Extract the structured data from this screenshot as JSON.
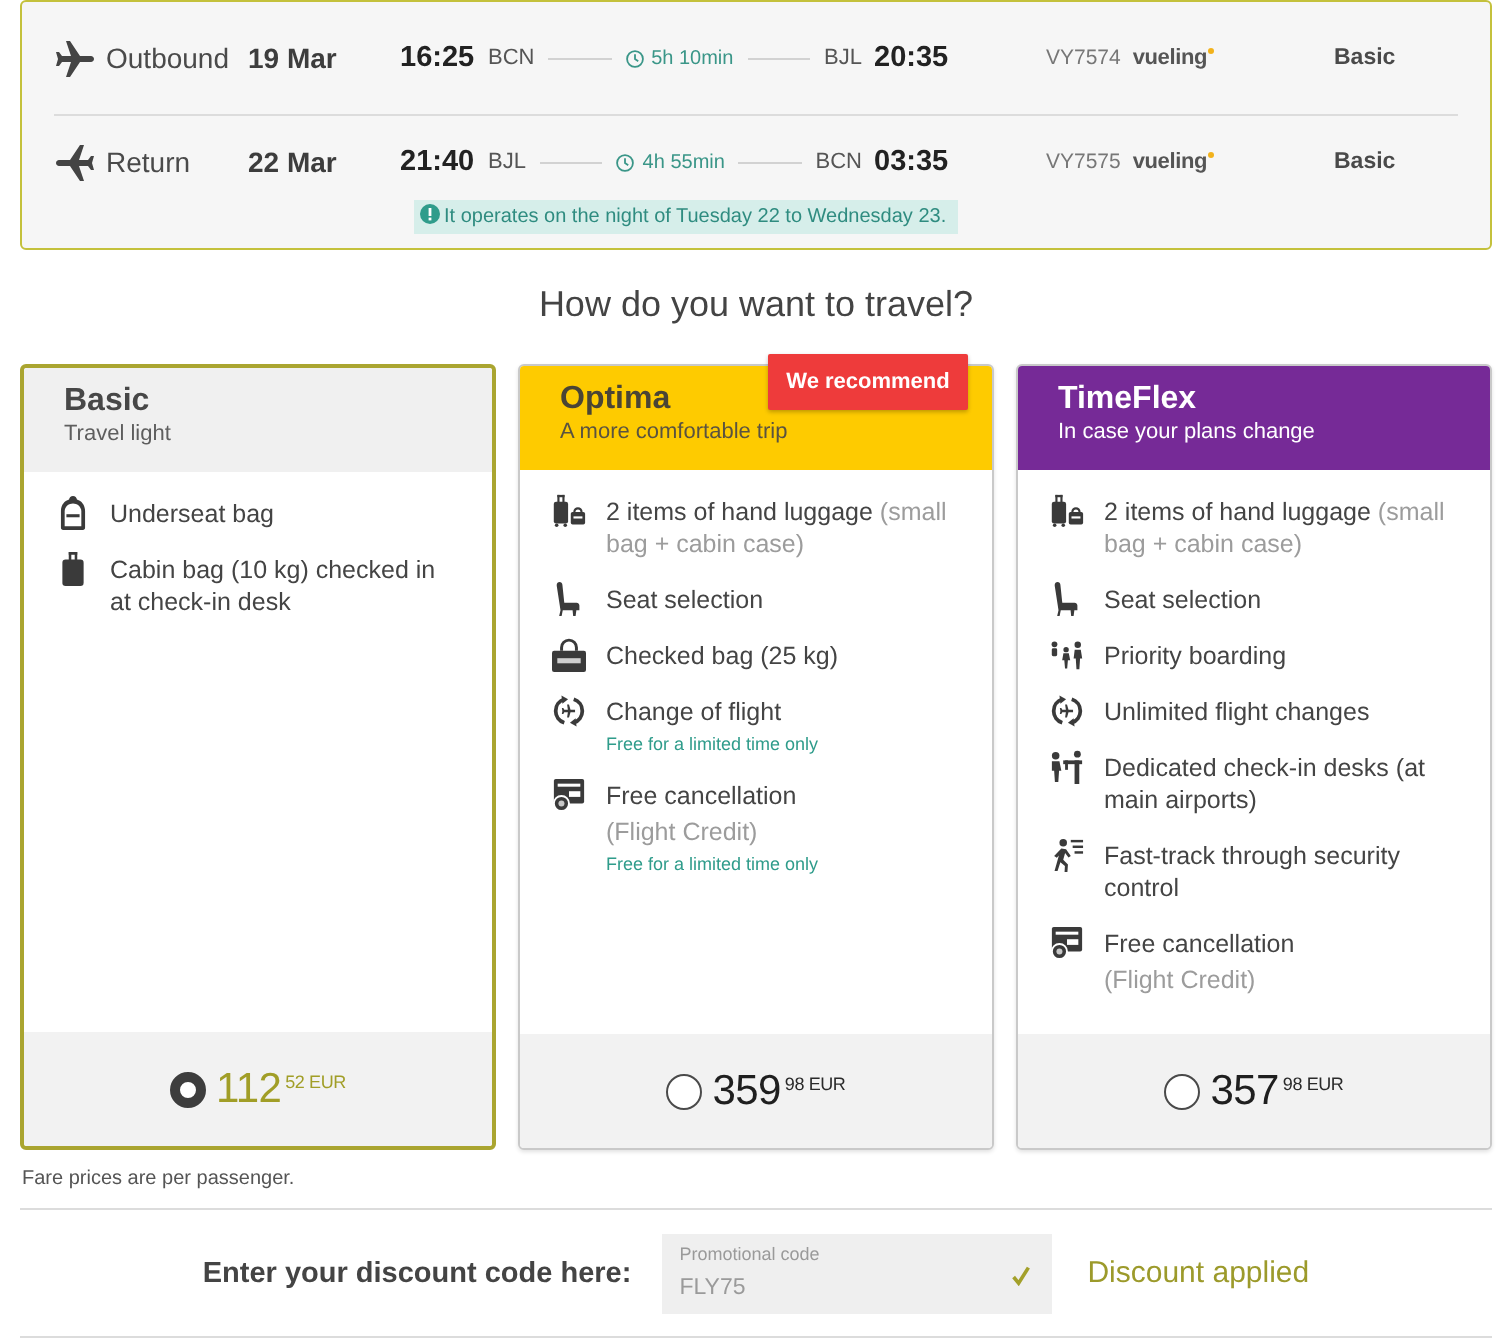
{
  "flights": [
    {
      "kind": "outbound",
      "label": "Outbound",
      "date": "19 Mar",
      "departure_time": "16:25",
      "departure_airport": "BCN",
      "duration": "5h 10min",
      "arrival_airport": "BJL",
      "arrival_time": "20:35",
      "flight_number": "VY7574",
      "airline": "vueling",
      "fare": "Basic"
    },
    {
      "kind": "return",
      "label": "Return",
      "date": "22 Mar",
      "departure_time": "21:40",
      "departure_airport": "BJL",
      "duration": "4h 55min",
      "arrival_airport": "BCN",
      "arrival_time": "03:35",
      "flight_number": "VY7575",
      "airline": "vueling",
      "fare": "Basic"
    }
  ],
  "notice": "It operates on the night of Tuesday 22 to Wednesday 23.",
  "heading": "How do you want to travel?",
  "fares": [
    {
      "kind": "standard",
      "name": "Basic",
      "tagline": "Travel light",
      "selected": true,
      "features": [
        {
          "kind": "backpack",
          "text": "Underseat bag"
        },
        {
          "kind": "suitcase",
          "text": "Cabin bag (10 kg) checked in at check-in desk"
        }
      ],
      "price": "112",
      "cents": "52 EUR"
    },
    {
      "kind": "recommended",
      "name": "Optima",
      "tagline": "A more comfortable trip",
      "badge": "We recommend",
      "selected": false,
      "features": [
        {
          "kind": "hand-luggage",
          "text": "2 items of hand luggage",
          "detail": "(small bag + cabin case)"
        },
        {
          "kind": "seat",
          "text": "Seat selection"
        },
        {
          "kind": "checked-bag",
          "text": "Checked bag (25 kg)"
        },
        {
          "kind": "change",
          "text": "Change of flight",
          "note": "Free for a limited time only"
        },
        {
          "kind": "cancellation",
          "text": "Free cancellation",
          "caption": "(Flight Credit)",
          "note": "Free for a limited time only"
        }
      ],
      "price": "359",
      "cents": "98 EUR"
    },
    {
      "kind": "flexible",
      "name": "TimeFlex",
      "tagline": "In case your plans change",
      "selected": false,
      "features": [
        {
          "kind": "hand-luggage",
          "text": "2 items of hand luggage",
          "detail": "(small bag + cabin case)"
        },
        {
          "kind": "seat",
          "text": "Seat selection"
        },
        {
          "kind": "priority",
          "text": "Priority boarding"
        },
        {
          "kind": "change",
          "text": "Unlimited flight changes"
        },
        {
          "kind": "desk",
          "text": "Dedicated check-in desks (at main airports)"
        },
        {
          "kind": "fast-track",
          "text": "Fast-track through security control"
        },
        {
          "kind": "cancellation",
          "text": "Free cancellation",
          "caption": "(Flight Credit)"
        }
      ],
      "price": "357",
      "cents": "98 EUR"
    }
  ],
  "note": "Fare prices are per passenger.",
  "discount": {
    "label": "Enter your discount code here:",
    "field_label": "Promotional code",
    "value": "FLY75",
    "applied": true,
    "status": "Discount applied"
  }
}
